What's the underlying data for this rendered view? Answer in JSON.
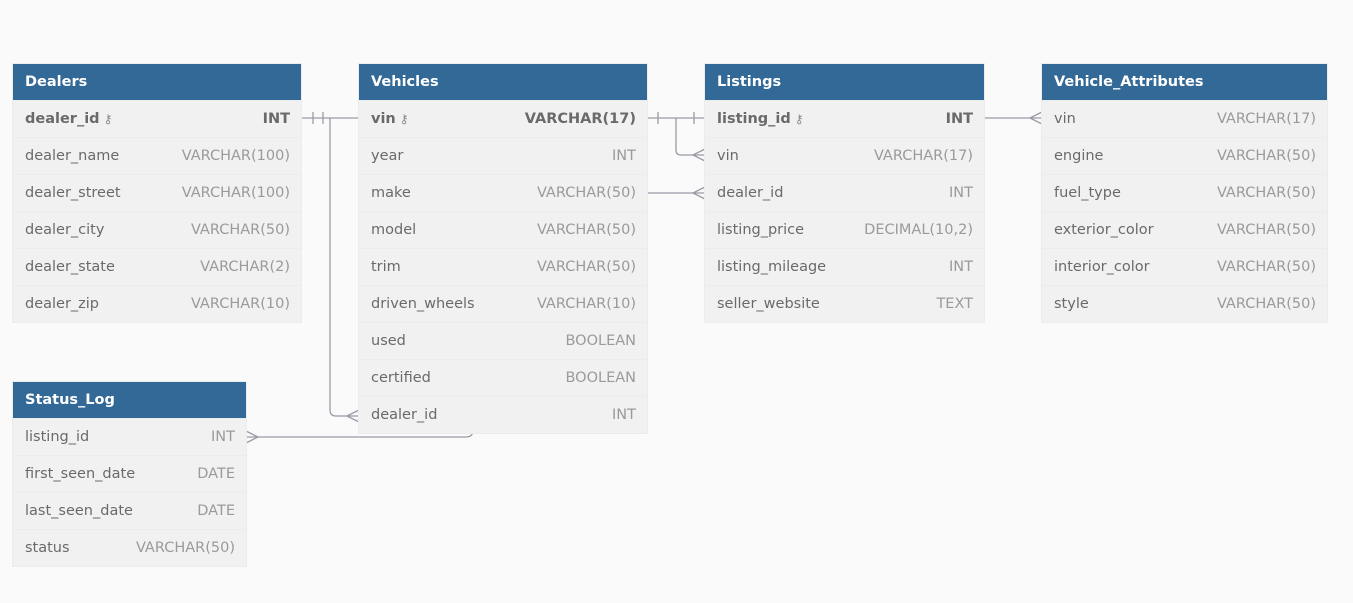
{
  "tables": [
    {
      "id": "dealers",
      "name": "Dealers",
      "columns": [
        {
          "name": "dealer_id",
          "type": "INT",
          "pk": true
        },
        {
          "name": "dealer_name",
          "type": "VARCHAR(100)"
        },
        {
          "name": "dealer_street",
          "type": "VARCHAR(100)"
        },
        {
          "name": "dealer_city",
          "type": "VARCHAR(50)"
        },
        {
          "name": "dealer_state",
          "type": "VARCHAR(2)"
        },
        {
          "name": "dealer_zip",
          "type": "VARCHAR(10)"
        }
      ]
    },
    {
      "id": "vehicles",
      "name": "Vehicles",
      "columns": [
        {
          "name": "vin",
          "type": "VARCHAR(17)",
          "pk": true
        },
        {
          "name": "year",
          "type": "INT"
        },
        {
          "name": "make",
          "type": "VARCHAR(50)"
        },
        {
          "name": "model",
          "type": "VARCHAR(50)"
        },
        {
          "name": "trim",
          "type": "VARCHAR(50)"
        },
        {
          "name": "driven_wheels",
          "type": "VARCHAR(10)"
        },
        {
          "name": "used",
          "type": "BOOLEAN"
        },
        {
          "name": "certified",
          "type": "BOOLEAN"
        },
        {
          "name": "dealer_id",
          "type": "INT"
        }
      ]
    },
    {
      "id": "listings",
      "name": "Listings",
      "columns": [
        {
          "name": "listing_id",
          "type": "INT",
          "pk": true
        },
        {
          "name": "vin",
          "type": "VARCHAR(17)"
        },
        {
          "name": "dealer_id",
          "type": "INT"
        },
        {
          "name": "listing_price",
          "type": "DECIMAL(10,2)"
        },
        {
          "name": "listing_mileage",
          "type": "INT"
        },
        {
          "name": "seller_website",
          "type": "TEXT"
        }
      ]
    },
    {
      "id": "vehicle-attributes",
      "name": "Vehicle_Attributes",
      "columns": [
        {
          "name": "vin",
          "type": "VARCHAR(17)"
        },
        {
          "name": "engine",
          "type": "VARCHAR(50)"
        },
        {
          "name": "fuel_type",
          "type": "VARCHAR(50)"
        },
        {
          "name": "exterior_color",
          "type": "VARCHAR(50)"
        },
        {
          "name": "interior_color",
          "type": "VARCHAR(50)"
        },
        {
          "name": "style",
          "type": "VARCHAR(50)"
        }
      ]
    },
    {
      "id": "status-log",
      "name": "Status_Log",
      "columns": [
        {
          "name": "listing_id",
          "type": "INT"
        },
        {
          "name": "first_seen_date",
          "type": "DATE"
        },
        {
          "name": "last_seen_date",
          "type": "DATE"
        },
        {
          "name": "status",
          "type": "VARCHAR(50)"
        }
      ]
    }
  ],
  "key_icon": "⚷",
  "colors": {
    "header": "#336997",
    "row": "#f1f1f1",
    "line": "#9a9aa6"
  }
}
